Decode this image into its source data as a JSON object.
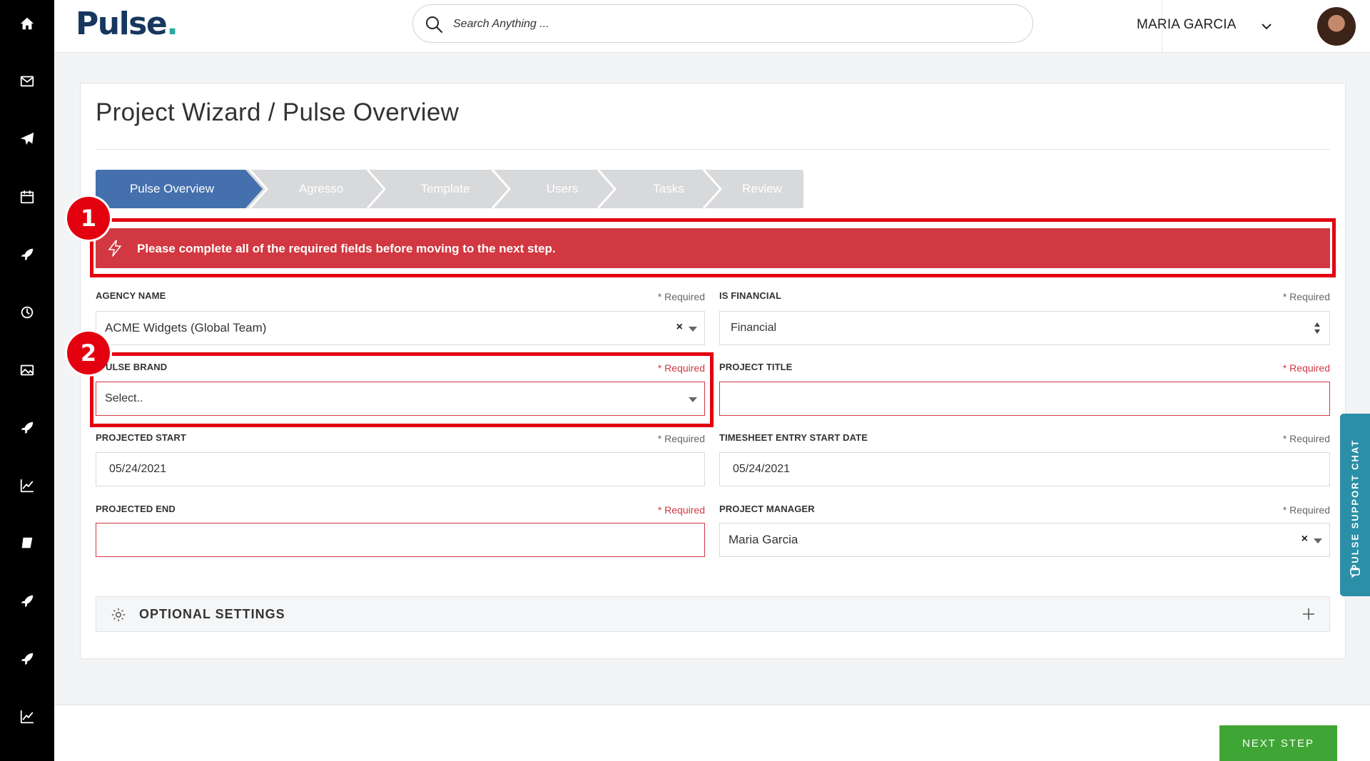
{
  "sidebar": {
    "items": [
      {
        "icon": "home-icon"
      },
      {
        "icon": "mail-icon"
      },
      {
        "icon": "send-icon"
      },
      {
        "icon": "calendar-icon"
      },
      {
        "icon": "rocket-icon"
      },
      {
        "icon": "clock-icon"
      },
      {
        "icon": "image-icon"
      },
      {
        "icon": "rocket-icon"
      },
      {
        "icon": "chart-icon"
      },
      {
        "icon": "book-icon"
      },
      {
        "icon": "rocket-icon"
      },
      {
        "icon": "rocket-icon"
      },
      {
        "icon": "chart-icon"
      }
    ]
  },
  "header": {
    "logo_main": "Pulse",
    "logo_dot": ".",
    "search_placeholder": "Search Anything ...",
    "user_name": "MARIA GARCIA"
  },
  "page": {
    "title": "Project Wizard / Pulse Overview"
  },
  "wizard": {
    "steps": [
      "Pulse Overview",
      "Agresso",
      "Template",
      "Users",
      "Tasks",
      "Review"
    ],
    "active": "Pulse Overview"
  },
  "alert": {
    "message": "Please complete all of the required fields before moving to the next step."
  },
  "annotations": [
    "1",
    "2"
  ],
  "form": {
    "agency_name": {
      "label": "AGENCY NAME",
      "required": "* Required",
      "value": "ACME Widgets (Global Team)",
      "clear": "×"
    },
    "is_financial": {
      "label": "IS FINANCIAL",
      "required": "* Required",
      "value": "Financial"
    },
    "pulse_brand": {
      "label": "ULSE BRAND",
      "required": "* Required",
      "value": "Select.."
    },
    "project_title": {
      "label": "PROJECT TITLE",
      "required": "* Required",
      "value": ""
    },
    "projected_start": {
      "label": "PROJECTED START",
      "required": "* Required",
      "value": "05/24/2021"
    },
    "timesheet_start": {
      "label": "TIMESHEET ENTRY START DATE",
      "required": "* Required",
      "value": "05/24/2021"
    },
    "projected_end": {
      "label": "PROJECTED END",
      "required": "* Required",
      "value": ""
    },
    "project_manager": {
      "label": "PROJECT MANAGER",
      "required": "* Required",
      "value": "Maria Garcia",
      "clear": "×"
    }
  },
  "optional_settings": {
    "label": "OPTIONAL SETTINGS"
  },
  "support_chat": {
    "label": "PULSE SUPPORT CHAT"
  },
  "footer": {
    "next_label": "NEXT STEP"
  },
  "colors": {
    "step_active": "#4470ad",
    "step_inactive": "#d8d9db",
    "alert_bg": "#d13841",
    "annotation": "#e3000f",
    "next_button": "#3fa535",
    "support_tab": "#2a8fa7",
    "logo": "#17375e"
  }
}
